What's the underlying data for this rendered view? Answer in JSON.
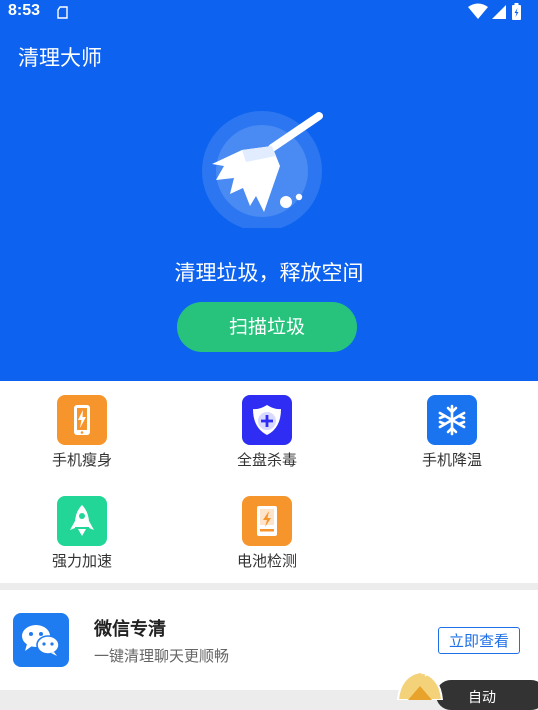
{
  "status_bar": {
    "time": "8:53",
    "left_icon": "sd-card-icon",
    "right_icons": [
      "wifi-icon",
      "signal-icon",
      "battery-charging-icon"
    ]
  },
  "header": {
    "title": "清理大师"
  },
  "hero": {
    "icon": "broom-icon",
    "subtitle": "清理垃圾，释放空间",
    "scan_button_label": "扫描垃圾"
  },
  "tools": [
    {
      "label": "手机瘦身",
      "icon": "phone-slim-icon",
      "color": "#f7952d"
    },
    {
      "label": "全盘杀毒",
      "icon": "shield-plus-icon",
      "color": "#2f2df3"
    },
    {
      "label": "手机降温",
      "icon": "snowflake-icon",
      "color": "#1a73ef"
    },
    {
      "label": "强力加速",
      "icon": "rocket-icon",
      "color": "#22d698"
    },
    {
      "label": "电池检测",
      "icon": "battery-check-icon",
      "color": "#f7952d"
    }
  ],
  "wechat_card": {
    "title": "微信专清",
    "description": "一键清理聊天更顺畅",
    "button_label": "立即查看",
    "icon": "wechat-icon"
  },
  "floating_badge": {
    "label": "自动",
    "icon": "home-shield-icon"
  },
  "colors": {
    "primary": "#0d63ef",
    "accent_green": "#27c37d",
    "link_blue": "#1f6fe8"
  }
}
